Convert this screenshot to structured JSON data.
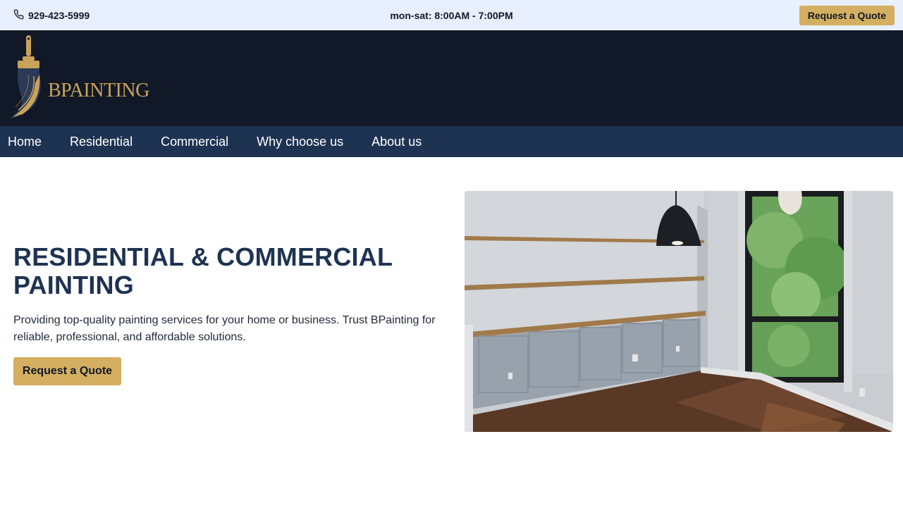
{
  "topbar": {
    "phone": "929-423-5999",
    "phone_icon": "phone-icon",
    "hours": "mon-sat: 8:00AM - 7:00PM",
    "quote_button": "Request a Quote"
  },
  "brand": {
    "logo_text": "BPAINTING",
    "logo_icon": "paintbrush-icon"
  },
  "nav": {
    "items": [
      "Home",
      "Residential",
      "Commercial",
      "Why choose us",
      "About us"
    ]
  },
  "hero": {
    "title_line1": "RESIDENTIAL & COMMERCIAL",
    "title_line2": "PAINTING",
    "description": "Providing top-quality painting services for your home or business. Trust BPainting for reliable, professional, and affordable solutions.",
    "button": "Request a Quote"
  },
  "colors": {
    "topbar_bg": "#e8efff",
    "brand_bg": "#111827",
    "nav_bg": "#1e3352",
    "accent_gold": "#d4af61",
    "title_navy": "#1e3352"
  }
}
